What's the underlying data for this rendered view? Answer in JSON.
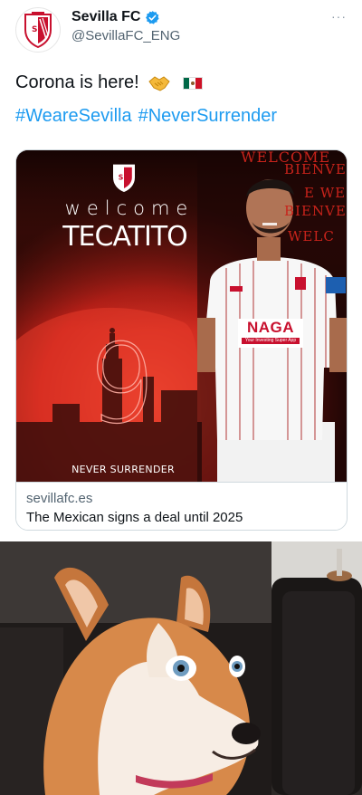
{
  "tweet": {
    "display_name": "Sevilla FC",
    "handle": "@SevillaFC_ENG",
    "more_label": "···",
    "text": "Corona is here!",
    "emojis": [
      "handshake-emoji",
      "mexico-flag-emoji"
    ],
    "hashtags": [
      "#WeareSevilla",
      "#NeverSurrender"
    ]
  },
  "card": {
    "image": {
      "welcome": "welcome",
      "player_name": "TECATITO",
      "number": "9",
      "slogan": "NEVER SURRENDER",
      "sponsor": "NAGA",
      "sponsor_tagline": "Your Investing Super App",
      "background_words": [
        "WELCOME",
        "BIENVENI",
        "E WEL",
        "BIENVENID",
        "WELC"
      ]
    },
    "domain": "sevillafc.es",
    "title": "The Mexican signs a deal until 2025"
  },
  "colors": {
    "link": "#1d9bf0",
    "verified": "#1d9bf0",
    "sevilla_red": "#d22b1d",
    "text": "#0f1419",
    "secondary": "#536471"
  }
}
